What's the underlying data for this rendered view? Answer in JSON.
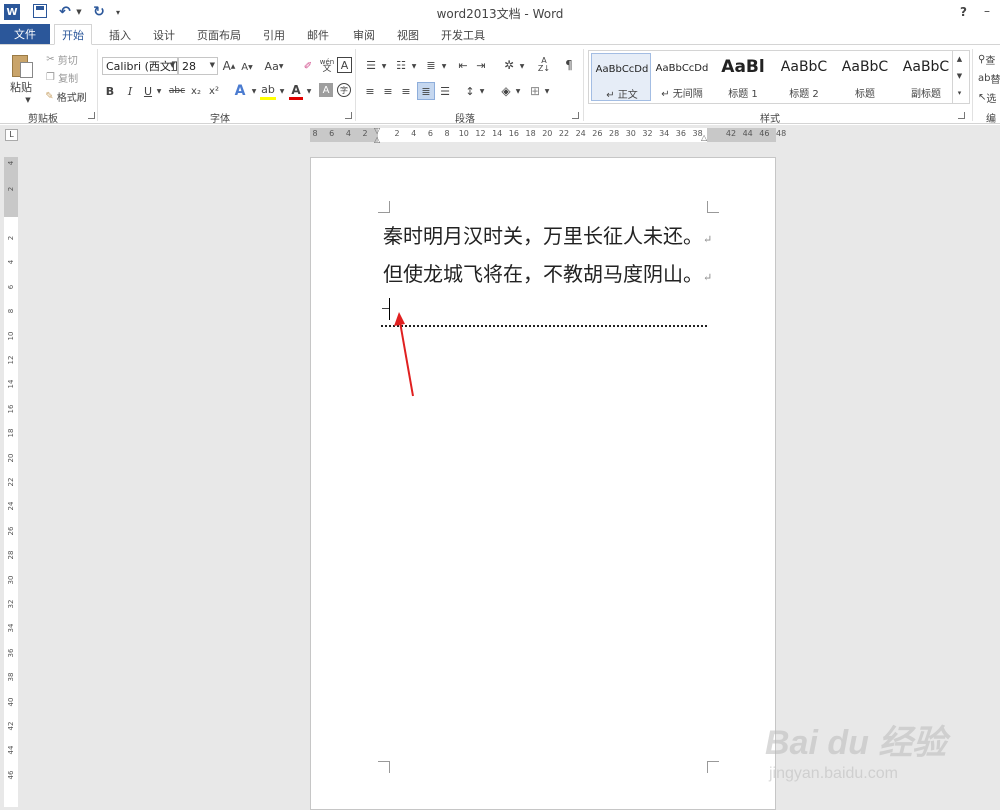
{
  "titlebar": {
    "app_icon_letter": "W",
    "title": "word2013文档 - Word",
    "help": "?",
    "minimize": "–"
  },
  "tabs": {
    "file": "文件",
    "items": [
      "开始",
      "插入",
      "设计",
      "页面布局",
      "引用",
      "邮件",
      "审阅",
      "视图",
      "开发工具"
    ],
    "active": "开始"
  },
  "clipboard": {
    "paste": "粘贴",
    "cut": "剪切",
    "copy": "复制",
    "format_painter": "格式刷",
    "label": "剪贴板"
  },
  "font": {
    "family": "Calibri (西文正",
    "size": "28",
    "bold": "B",
    "italic": "I",
    "underline": "U",
    "strike": "abc",
    "subscript": "x₂",
    "superscript": "x²",
    "grow": "A",
    "shrink": "A",
    "change_case": "Aa",
    "font_color": "A",
    "phonetic": "wén",
    "label": "字体"
  },
  "paragraph": {
    "label": "段落"
  },
  "styles": {
    "label": "样式",
    "items": [
      {
        "sample": "AaBbCcDd",
        "name": "↵ 正文"
      },
      {
        "sample": "AaBbCcDd",
        "name": "↵ 无间隔"
      },
      {
        "sample": "AaBl",
        "name": "标题 1"
      },
      {
        "sample": "AaBbC",
        "name": "标题 2"
      },
      {
        "sample": "AaBbC",
        "name": "标题"
      },
      {
        "sample": "AaBbC",
        "name": "副标题"
      }
    ]
  },
  "editing": {
    "find": "查",
    "replace": "替",
    "select": "选",
    "label": "编"
  },
  "ruler": {
    "corner": "L",
    "h_left": [
      "8",
      "6",
      "4",
      "2"
    ],
    "h_right": [
      "2",
      "4",
      "6",
      "8",
      "10",
      "12",
      "14",
      "16",
      "18",
      "20",
      "22",
      "24",
      "26",
      "28",
      "30",
      "32",
      "34",
      "36",
      "38",
      "42",
      "44",
      "46",
      "48"
    ],
    "v_top": [
      "4",
      "2"
    ],
    "v_main": [
      "2",
      "4",
      "6",
      "8",
      "10",
      "12",
      "14",
      "16",
      "18",
      "20",
      "22",
      "24",
      "26",
      "28",
      "30",
      "32",
      "34",
      "36",
      "38",
      "40",
      "42",
      "44",
      "46"
    ]
  },
  "document": {
    "line1": "秦时明月汉时关，万里长征人未还。",
    "line2": "但使龙城飞将在，不教胡马度阴山。",
    "pilcrow": "↵"
  },
  "watermark": {
    "brand": "Bai du 经验",
    "url": "jingyan.baidu.com"
  },
  "colors": {
    "accent": "#2b579a",
    "arrow": "#e02020"
  }
}
